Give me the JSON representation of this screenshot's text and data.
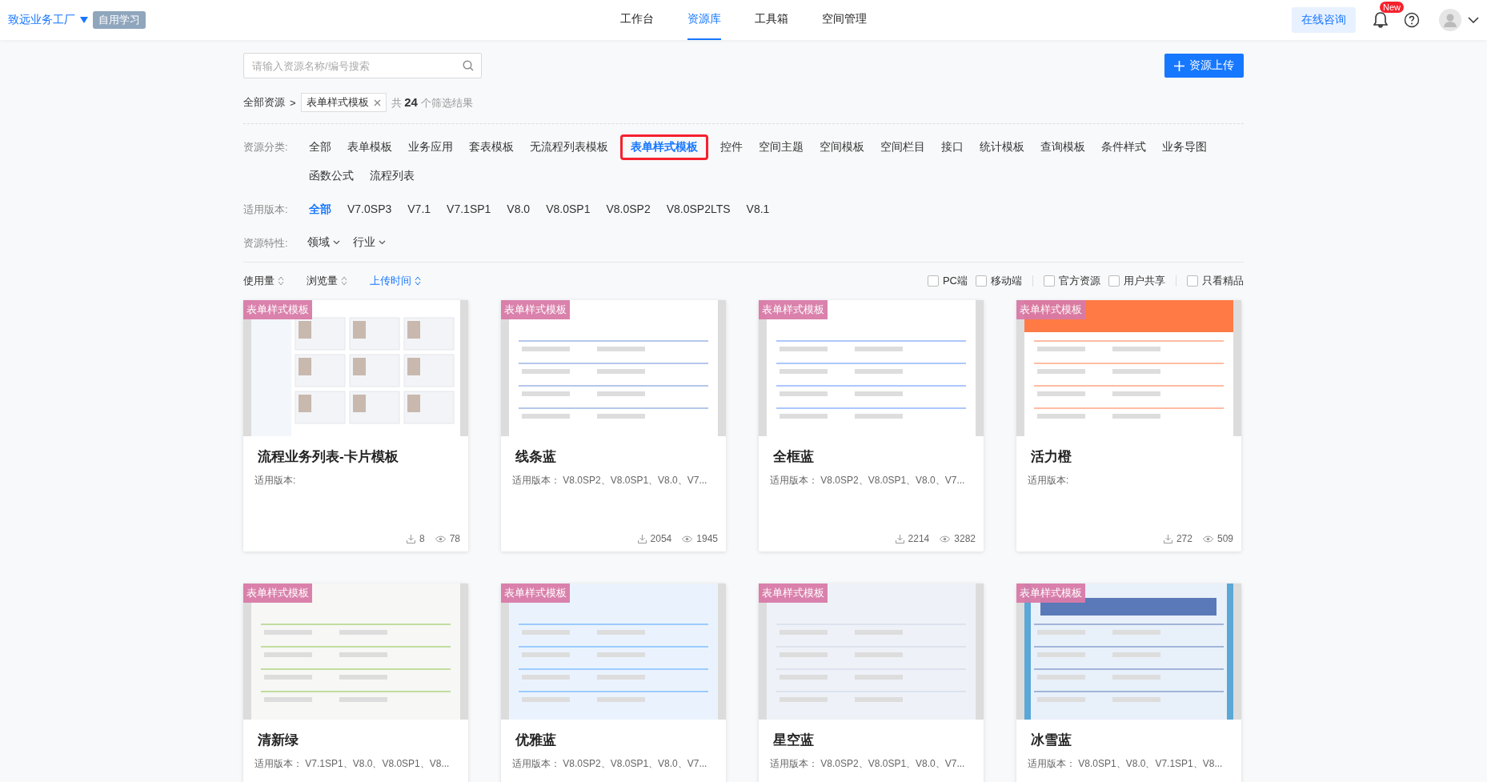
{
  "header": {
    "brand": "致远业务工厂",
    "badge": "自用学习",
    "nav": [
      {
        "label": "工作台",
        "selected": false
      },
      {
        "label": "资源库",
        "selected": true
      },
      {
        "label": "工具箱",
        "selected": false
      },
      {
        "label": "空间管理",
        "selected": false
      }
    ],
    "consult_button": "在线咨询",
    "notification_badge": "New"
  },
  "search": {
    "placeholder": "请输入资源名称/编号搜索"
  },
  "upload_button": "资源上传",
  "breadcrumb": {
    "root": "全部资源",
    "separator": ">",
    "tag": "表单样式模板",
    "result": "共 **24** 个筛选结果"
  },
  "filters": [
    {
      "label": "资源分类:",
      "options": [
        {
          "label": "全部",
          "selected": false,
          "highlighted": false
        },
        {
          "label": "表单模板",
          "selected": false,
          "highlighted": false
        },
        {
          "label": "业务应用",
          "selected": false,
          "highlighted": false
        },
        {
          "label": "套表模板",
          "selected": false,
          "highlighted": false
        },
        {
          "label": "无流程列表模板",
          "selected": false,
          "highlighted": false
        },
        {
          "label": "表单样式模板",
          "selected": true,
          "highlighted": true
        },
        {
          "label": "控件",
          "selected": false,
          "highlighted": false
        },
        {
          "label": "空间主题",
          "selected": false,
          "highlighted": false
        },
        {
          "label": "空间模板",
          "selected": false,
          "highlighted": false
        },
        {
          "label": "空间栏目",
          "selected": false,
          "highlighted": false
        },
        {
          "label": "接口",
          "selected": false,
          "highlighted": false
        },
        {
          "label": "统计模板",
          "selected": false,
          "highlighted": false
        },
        {
          "label": "查询模板",
          "selected": false,
          "highlighted": false
        },
        {
          "label": "条件样式",
          "selected": false,
          "highlighted": false
        },
        {
          "label": "业务导图",
          "selected": false,
          "highlighted": false
        },
        {
          "label": "函数公式",
          "selected": false,
          "highlighted": false
        },
        {
          "label": "流程列表",
          "selected": false,
          "highlighted": false
        }
      ]
    },
    {
      "label": "适用版本:",
      "options": [
        {
          "label": "全部",
          "selected": true,
          "highlighted": false
        },
        {
          "label": "V7.0SP3",
          "selected": false,
          "highlighted": false
        },
        {
          "label": "V7.1",
          "selected": false,
          "highlighted": false
        },
        {
          "label": "V7.1SP1",
          "selected": false,
          "highlighted": false
        },
        {
          "label": "V8.0",
          "selected": false,
          "highlighted": false
        },
        {
          "label": "V8.0SP1",
          "selected": false,
          "highlighted": false
        },
        {
          "label": "V8.0SP2",
          "selected": false,
          "highlighted": false
        },
        {
          "label": "V8.0SP2LTS",
          "selected": false,
          "highlighted": false
        },
        {
          "label": "V8.1",
          "selected": false,
          "highlighted": false
        }
      ]
    }
  ],
  "traits": {
    "label": "资源特性:",
    "dropdowns": [
      "领域",
      "行业"
    ]
  },
  "sort": [
    {
      "label": "使用量",
      "selected": false
    },
    {
      "label": "浏览量",
      "selected": false
    },
    {
      "label": "上传时间",
      "selected": true
    }
  ],
  "checkboxes": [
    {
      "label": "PC端",
      "checked": false
    },
    {
      "label": "移动端",
      "checked": false
    },
    {
      "label": "官方资源",
      "checked": false
    },
    {
      "label": "用户共享",
      "checked": false
    },
    {
      "label": "只看精品",
      "checked": false
    }
  ],
  "cards": [
    {
      "tag": "表单样式模板",
      "title": "流程业务列表-卡片模板",
      "versions": "适用版本:",
      "downloads": "8",
      "views": "78"
    },
    {
      "tag": "表单样式模板",
      "title": "线条蓝",
      "versions": "适用版本： V8.0SP2、V8.0SP1、V8.0、V7...",
      "downloads": "2054",
      "views": "1945"
    },
    {
      "tag": "表单样式模板",
      "title": "全框蓝",
      "versions": "适用版本： V8.0SP2、V8.0SP1、V8.0、V7...",
      "downloads": "2214",
      "views": "3282"
    },
    {
      "tag": "表单样式模板",
      "title": "活力橙",
      "versions": "适用版本:",
      "downloads": "272",
      "views": "509"
    },
    {
      "tag": "表单样式模板",
      "title": "清新绿",
      "versions": "适用版本： V7.1SP1、V8.0、V8.0SP1、V8..."
    },
    {
      "tag": "表单样式模板",
      "title": "优雅蓝",
      "versions": "适用版本： V8.0SP2、V8.0SP1、V8.0、V7..."
    },
    {
      "tag": "表单样式模板",
      "title": "星空蓝",
      "versions": "适用版本： V8.0SP2、V8.0SP1、V8.0、V7..."
    },
    {
      "tag": "表单样式模板",
      "title": "冰雪蓝",
      "versions": "适用版本： V8.0SP1、V8.0、V7.1SP1、V8..."
    }
  ]
}
